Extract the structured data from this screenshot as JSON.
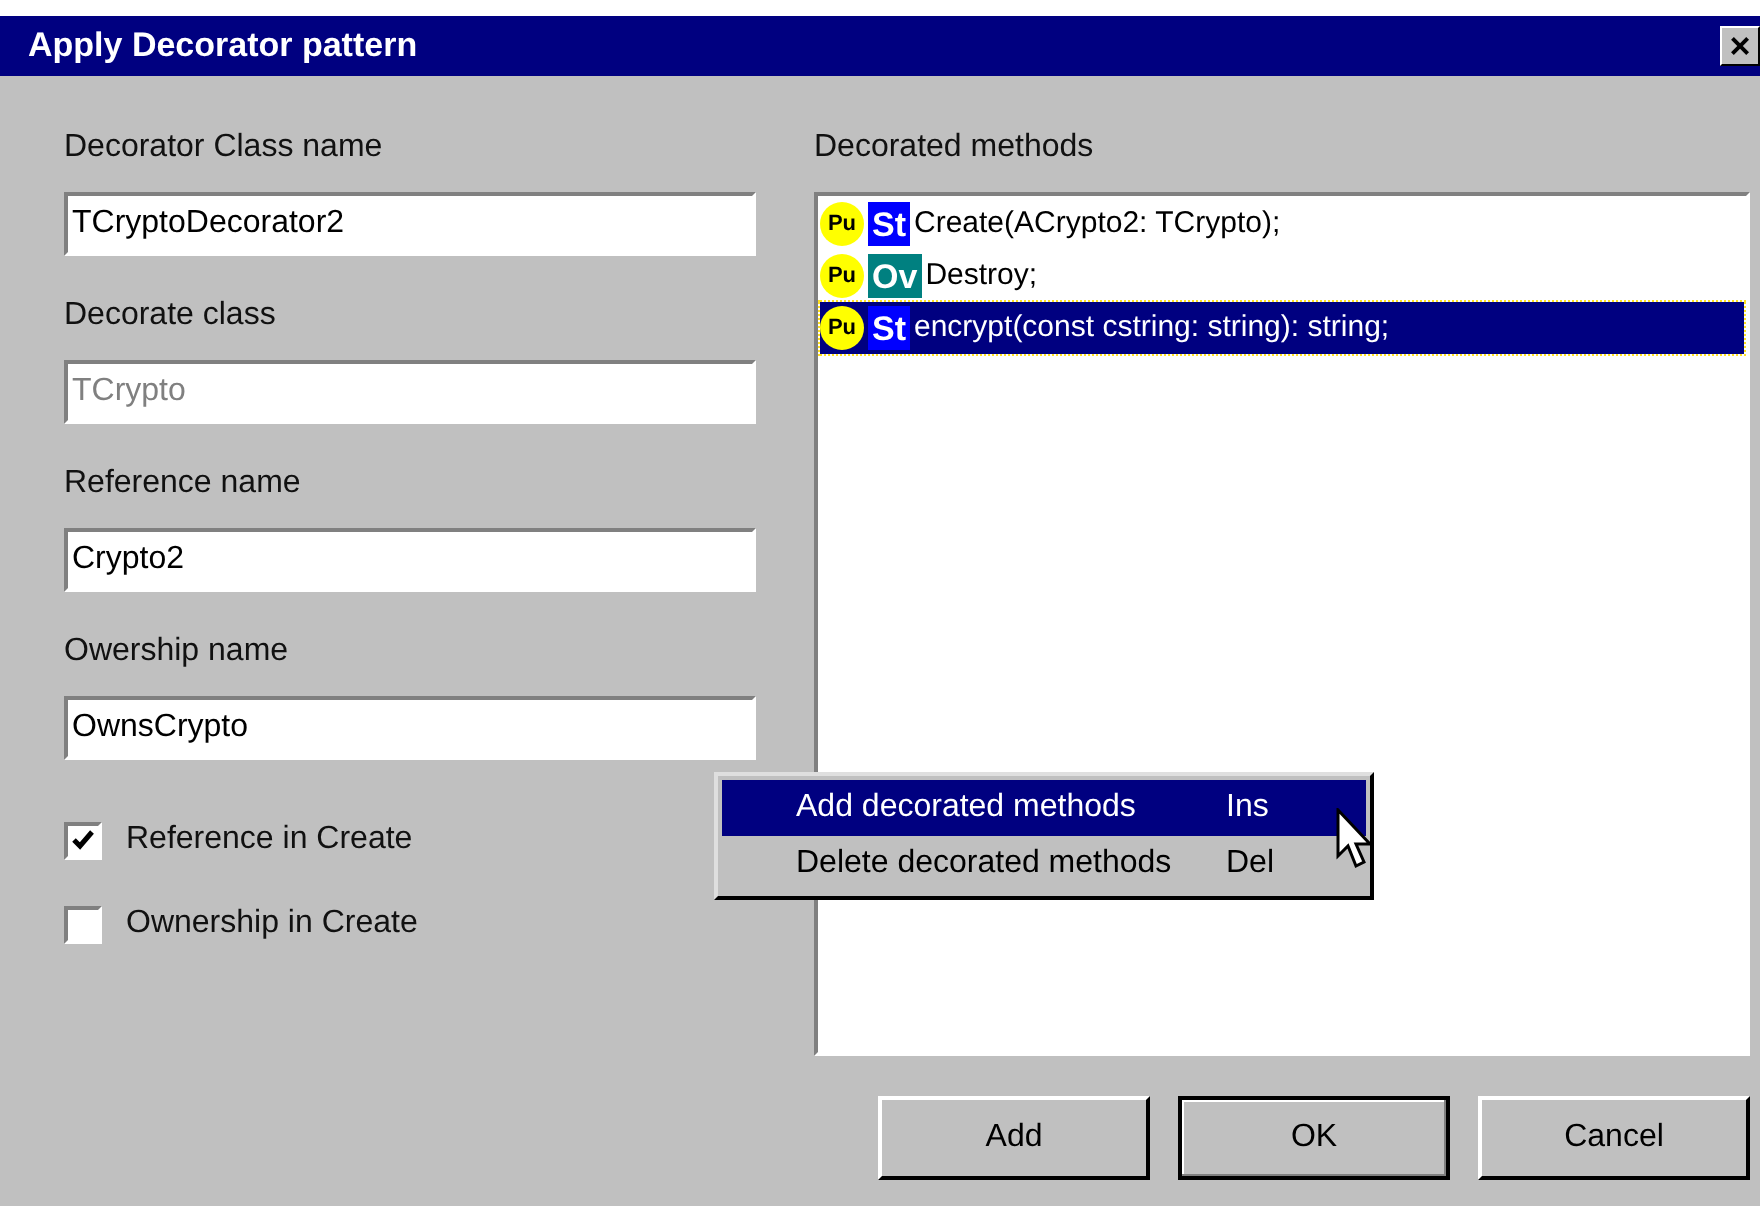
{
  "window": {
    "title": "Apply Decorator pattern",
    "close": "×"
  },
  "fields": [
    {
      "label": "Decorator Class name",
      "value": "TCryptoDecorator2",
      "disabled": false
    },
    {
      "label": "Decorate class",
      "value": "TCrypto",
      "disabled": true
    },
    {
      "label": "Reference name",
      "value": "Crypto2",
      "disabled": false
    },
    {
      "label": "Owership name",
      "value": "OwnsCrypto",
      "disabled": false
    }
  ],
  "checkboxes": [
    {
      "label": "Reference in Create",
      "checked": true
    },
    {
      "label": "Ownership in Create",
      "checked": false
    }
  ],
  "methods": {
    "label": "Decorated methods",
    "items": [
      {
        "visibility": "Pu",
        "directive": "St",
        "color": "#0000ff",
        "signature": "Create(ACrypto2: TCrypto);",
        "selected": false
      },
      {
        "visibility": "Pu",
        "directive": "Ov",
        "color": "#008080",
        "signature": "Destroy;",
        "selected": false
      },
      {
        "visibility": "Pu",
        "directive": "St",
        "color": "#0000ff",
        "signature": "encrypt(const cstring: string): string;",
        "selected": true
      }
    ]
  },
  "context_menu": [
    {
      "label": "Add decorated methods",
      "shortcut": "Ins",
      "selected": true
    },
    {
      "label": "Delete decorated methods",
      "shortcut": "Del",
      "selected": false
    }
  ],
  "buttons": [
    {
      "label": "Add",
      "default": false
    },
    {
      "label": "OK",
      "default": true
    },
    {
      "label": "Cancel",
      "default": false
    }
  ]
}
